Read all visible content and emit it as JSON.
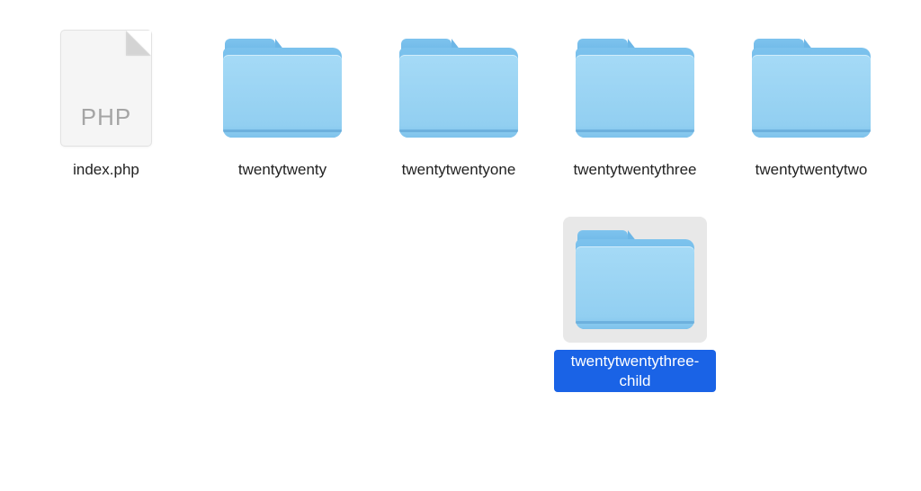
{
  "items": [
    {
      "kind": "file",
      "name": "index.php",
      "fileType": "PHP",
      "selected": false
    },
    {
      "kind": "folder",
      "name": "twentytwenty",
      "selected": false
    },
    {
      "kind": "folder",
      "name": "twentytwentyone",
      "selected": false
    },
    {
      "kind": "folder",
      "name": "twentytwentythree",
      "selected": false
    },
    {
      "kind": "folder",
      "name": "twentytwentytwo",
      "selected": false
    },
    {
      "kind": "spacer"
    },
    {
      "kind": "spacer"
    },
    {
      "kind": "spacer"
    },
    {
      "kind": "folder",
      "name": "twentytwentythree-child",
      "selected": true
    }
  ]
}
